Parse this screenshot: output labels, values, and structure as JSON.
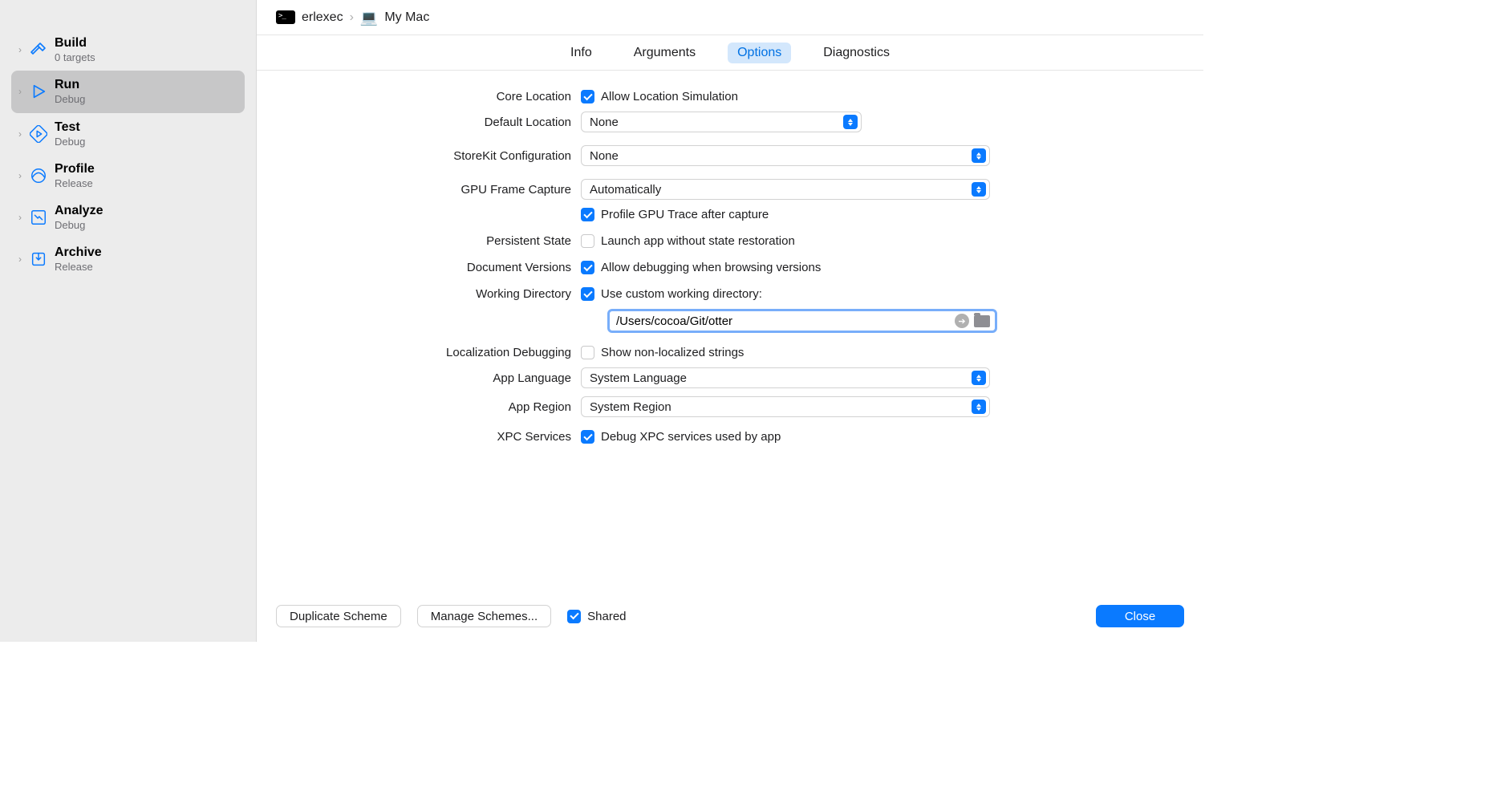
{
  "sidebar": {
    "items": [
      {
        "title": "Build",
        "subtitle": "0 targets"
      },
      {
        "title": "Run",
        "subtitle": "Debug"
      },
      {
        "title": "Test",
        "subtitle": "Debug"
      },
      {
        "title": "Profile",
        "subtitle": "Release"
      },
      {
        "title": "Analyze",
        "subtitle": "Debug"
      },
      {
        "title": "Archive",
        "subtitle": "Release"
      }
    ]
  },
  "breadcrumb": {
    "scheme": "erlexec",
    "target": "My Mac"
  },
  "tabs": {
    "info": "Info",
    "arguments": "Arguments",
    "options": "Options",
    "diagnostics": "Diagnostics"
  },
  "form": {
    "core_location_label": "Core Location",
    "core_location_check": "Allow Location Simulation",
    "default_location_label": "Default Location",
    "default_location_value": "None",
    "storekit_label": "StoreKit Configuration",
    "storekit_value": "None",
    "gpu_label": "GPU Frame Capture",
    "gpu_value": "Automatically",
    "gpu_profile_check": "Profile GPU Trace after capture",
    "persistent_label": "Persistent State",
    "persistent_check": "Launch app without state restoration",
    "docver_label": "Document Versions",
    "docver_check": "Allow debugging when browsing versions",
    "workdir_label": "Working Directory",
    "workdir_check": "Use custom working directory:",
    "workdir_value": "/Users/cocoa/Git/otter",
    "locdebug_label": "Localization Debugging",
    "locdebug_check": "Show non-localized strings",
    "applang_label": "App Language",
    "applang_value": "System Language",
    "appregion_label": "App Region",
    "appregion_value": "System Region",
    "xpc_label": "XPC Services",
    "xpc_check": "Debug XPC services used by app"
  },
  "footer": {
    "duplicate": "Duplicate Scheme",
    "manage": "Manage Schemes...",
    "shared": "Shared",
    "close": "Close"
  }
}
